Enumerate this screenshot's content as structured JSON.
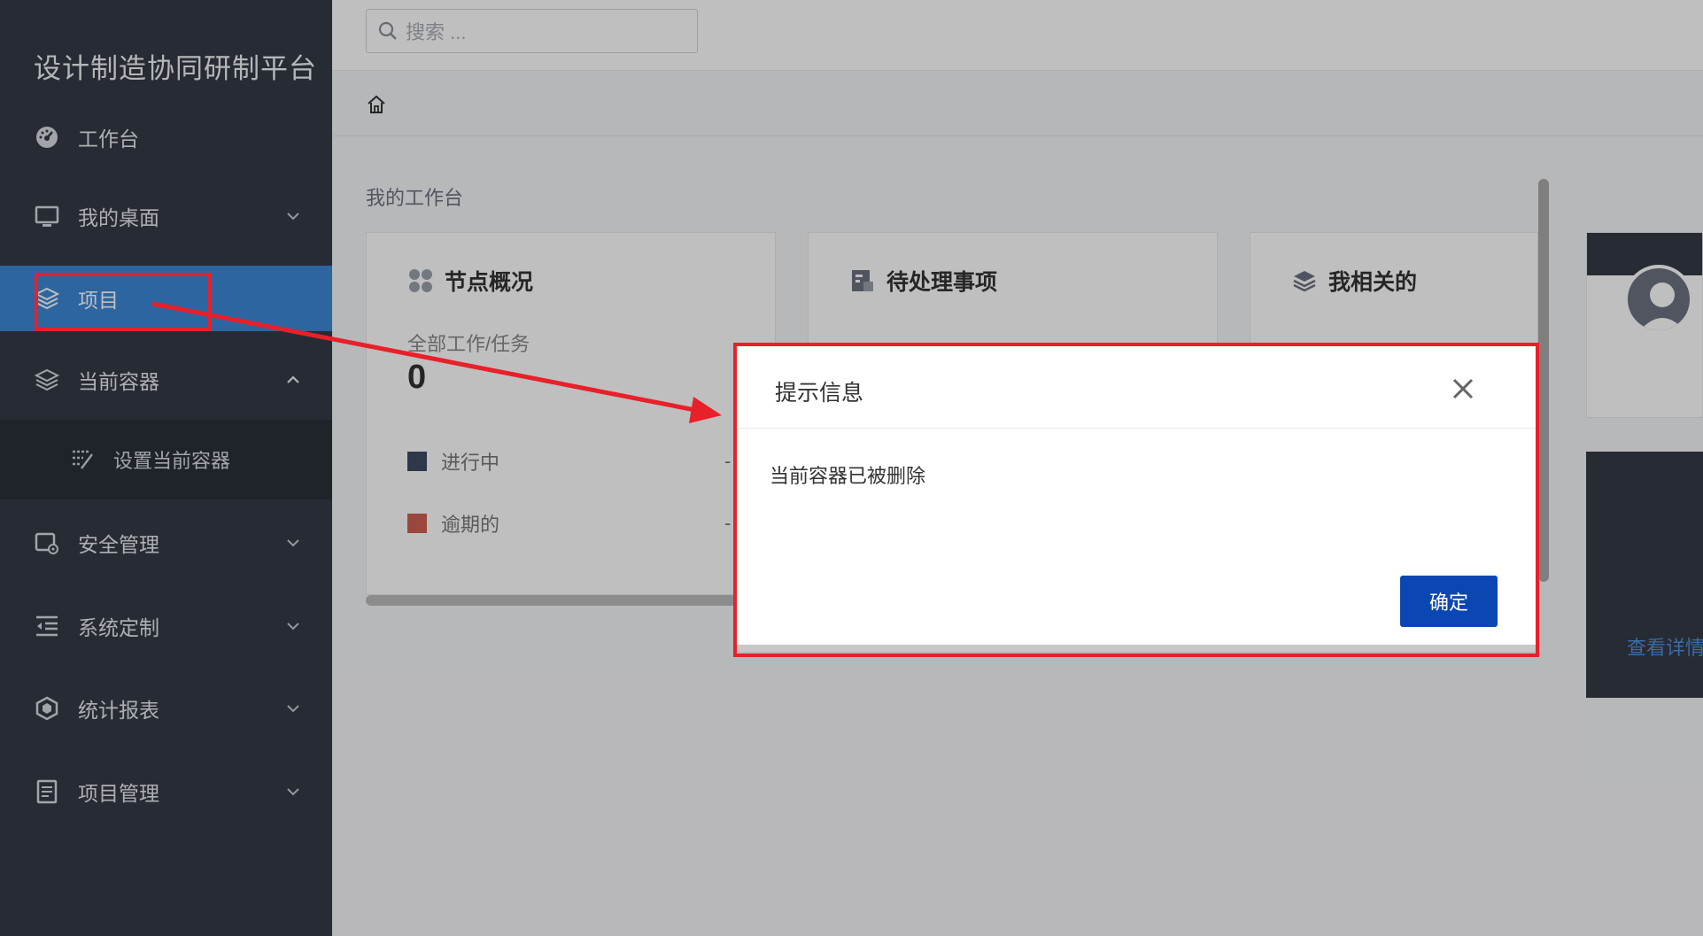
{
  "app": {
    "title": "设计制造协同研制平台"
  },
  "sidebar": {
    "items": [
      {
        "label": "工作台",
        "icon": "dashboard-icon"
      },
      {
        "label": "我的桌面",
        "icon": "monitor-icon"
      },
      {
        "label": "项目",
        "icon": "layers-icon"
      },
      {
        "label": "当前容器",
        "icon": "layers-icon"
      },
      {
        "label": "安全管理",
        "icon": "security-settings-icon"
      },
      {
        "label": "系统定制",
        "icon": "indent-list-icon"
      },
      {
        "label": "统计报表",
        "icon": "hexagon-icon"
      },
      {
        "label": "项目管理",
        "icon": "document-icon"
      }
    ],
    "submenu": {
      "label": "设置当前容器",
      "icon": "edit-list-icon"
    }
  },
  "header": {
    "search_placeholder": "搜索 ..."
  },
  "main": {
    "section_title": "我的工作台",
    "cards": [
      {
        "title": "节点概况",
        "icon": "nodes-icon"
      },
      {
        "title": "待处理事项",
        "icon": "pending-doc-icon"
      },
      {
        "title": "我相关的",
        "icon": "stack-icon"
      }
    ],
    "overview": {
      "total_label": "全部工作/任务",
      "total_value": "0",
      "legend": [
        {
          "label": "进行中",
          "color": "#3f4a63",
          "value": "-"
        },
        {
          "label": "逾期的",
          "color": "#cf5f52",
          "value": "-"
        }
      ]
    },
    "side_link": "查看详情"
  },
  "dialog": {
    "title": "提示信息",
    "message": "当前容器已被删除",
    "ok_label": "确定"
  },
  "colors": {
    "sidebar_bg": "#343a46",
    "active_item": "#3c87d6",
    "primary_button": "#0b47b3",
    "annotation": "#e8202a"
  }
}
